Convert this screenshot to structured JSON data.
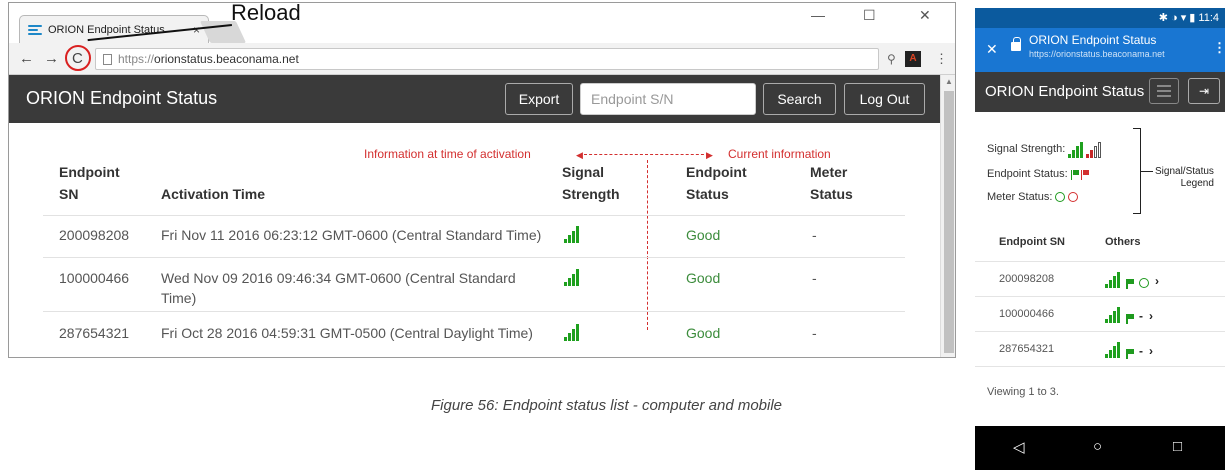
{
  "callout": {
    "label": "Reload"
  },
  "desktop": {
    "tab_title": "ORION Endpoint Status",
    "tab_close": "×",
    "window_controls": [
      "—",
      "☐",
      "✕"
    ],
    "url_scheme": "https://",
    "url_host": "orionstatus.beaconama.net",
    "brand": "ORION Endpoint Status",
    "export_label": "Export",
    "search_placeholder": "Endpoint S/N",
    "search_label": "Search",
    "logout_label": "Log Out",
    "annot_left": "Information at time of activation",
    "annot_right": "Current information",
    "columns": {
      "sn": [
        "Endpoint",
        "SN"
      ],
      "activation": "Activation Time",
      "signal": [
        "Signal",
        "Strength"
      ],
      "status": [
        "Endpoint",
        "Status"
      ],
      "meter": [
        "Meter",
        "Status"
      ]
    },
    "rows": [
      {
        "sn": "200098208",
        "time": "Fri Nov 11 2016 06:23:12 GMT-0600 (Central Standard Time)",
        "signal_bars": 4,
        "status": "Good",
        "meter": "-"
      },
      {
        "sn": "100000466",
        "time": "Wed Nov 09 2016 09:46:34 GMT-0600 (Central Standard Time)",
        "signal_bars": 4,
        "status": "Good",
        "meter": "-"
      },
      {
        "sn": "287654321",
        "time": "Fri Oct 28 2016 04:59:31 GMT-0500 (Central Daylight Time)",
        "signal_bars": 4,
        "status": "Good",
        "meter": "-"
      }
    ]
  },
  "caption": "Figure 56:  Endpoint status list - computer and mobile",
  "mobile": {
    "status_time": "11:4",
    "status_icons": "✱ ◑ ▾ ▮",
    "page_title": "ORION Endpoint Status",
    "page_url": "https://orionstatus.beaconama.net",
    "brand": "ORION Endpoint Status",
    "legend": {
      "signal": "Signal Strength:",
      "endpoint": "Endpoint Status:",
      "meter": "Meter Status:",
      "brace_label": [
        "Signal/Status",
        "Legend"
      ]
    },
    "columns": {
      "sn": "Endpoint SN",
      "others": "Others"
    },
    "rows": [
      {
        "sn": "200098208",
        "meter": "gauge"
      },
      {
        "sn": "100000466",
        "meter": "-"
      },
      {
        "sn": "287654321",
        "meter": "-"
      }
    ],
    "footer": "Viewing 1 to 3.",
    "nav": [
      "◁",
      "○",
      "□"
    ]
  },
  "colors": {
    "header": "#3a3a3a",
    "good": "#3c8c3c",
    "annotation": "#d32f2f",
    "mobile_bar": "#1976d2",
    "signal": "#1ea01e"
  }
}
